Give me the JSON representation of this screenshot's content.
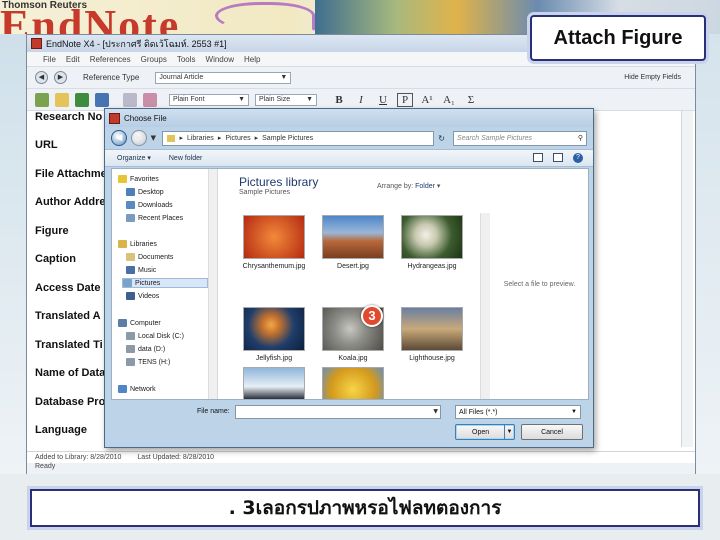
{
  "banner": {
    "publisher": "Thomson Reuters",
    "logo_text": "EndNote"
  },
  "callout": {
    "text": "Attach Figure"
  },
  "endnote": {
    "window_title": "EndNote X4 - [ประกาศรี ดิดเว้โฉมห์. 2553 #1]",
    "menu": [
      "File",
      "Edit",
      "References",
      "Groups",
      "Tools",
      "Window",
      "Help"
    ],
    "reference_type_label": "Reference Type",
    "reference_type_value": "Journal Article",
    "font_value": "Plain Font",
    "size_value": "Plain Size",
    "format_buttons": [
      "B",
      "I",
      "U",
      "P",
      "A¹",
      "A₁",
      "Σ"
    ],
    "hide_empty_fields": "Hide Empty Fields",
    "fields": [
      "Research No",
      "URL",
      "File Attachme",
      "Author Addre",
      "Figure",
      "Caption",
      "Access Date",
      "Translated A",
      "Translated Ti",
      "Name of Data",
      "Database Pro",
      "Language"
    ],
    "status_added": "Added to Library: 8/28/2010",
    "status_updated": "Last Updated: 8/28/2010",
    "status_ready": "Ready"
  },
  "dialog": {
    "title": "Choose File",
    "breadcrumb": [
      "Libraries",
      "Pictures",
      "Sample Pictures"
    ],
    "search_placeholder": "Search Sample Pictures",
    "organize": "Organize",
    "new_folder": "New folder",
    "nav_items": [
      {
        "label": "Favorites",
        "kind": "group"
      },
      {
        "label": "Desktop",
        "kind": "item"
      },
      {
        "label": "Downloads",
        "kind": "item"
      },
      {
        "label": "Recent Places",
        "kind": "item"
      },
      {
        "label": "Libraries",
        "kind": "group"
      },
      {
        "label": "Documents",
        "kind": "item"
      },
      {
        "label": "Music",
        "kind": "item"
      },
      {
        "label": "Pictures",
        "kind": "item"
      },
      {
        "label": "Videos",
        "kind": "item"
      },
      {
        "label": "Computer",
        "kind": "group"
      },
      {
        "label": "Local Disk (C:)",
        "kind": "item"
      },
      {
        "label": "data (D:)",
        "kind": "item"
      },
      {
        "label": "TENS (H:)",
        "kind": "item"
      },
      {
        "label": "Network",
        "kind": "group"
      }
    ],
    "library_title": "Pictures library",
    "library_subtitle": "Sample Pictures",
    "arrange_by_label": "Arrange by:",
    "arrange_by_value": "Folder",
    "files": [
      {
        "name": "Chrysanthemum.jpg",
        "color": "#d9461f"
      },
      {
        "name": "Desert.jpg",
        "color": "#b8683a"
      },
      {
        "name": "Hydrangeas.jpg",
        "color": "#6f8c55"
      },
      {
        "name": "Jellyfish.jpg",
        "color": "#1f3e6b"
      },
      {
        "name": "Koala.jpg",
        "color": "#8c8d88"
      },
      {
        "name": "Lighthouse.jpg",
        "color": "#6b7fa1"
      },
      {
        "name": "",
        "color": "#3a78b0"
      },
      {
        "name": "",
        "color": "#e3b62b"
      }
    ],
    "preview_text": "Select a file to preview.",
    "file_name_label": "File name:",
    "file_filter": "All Files (*.*)",
    "open_label": "Open",
    "cancel_label": "Cancel"
  },
  "step_marker": "3",
  "caption": {
    "text": ". 3เลอกรปภาพหรอไฟลทตองการ"
  }
}
